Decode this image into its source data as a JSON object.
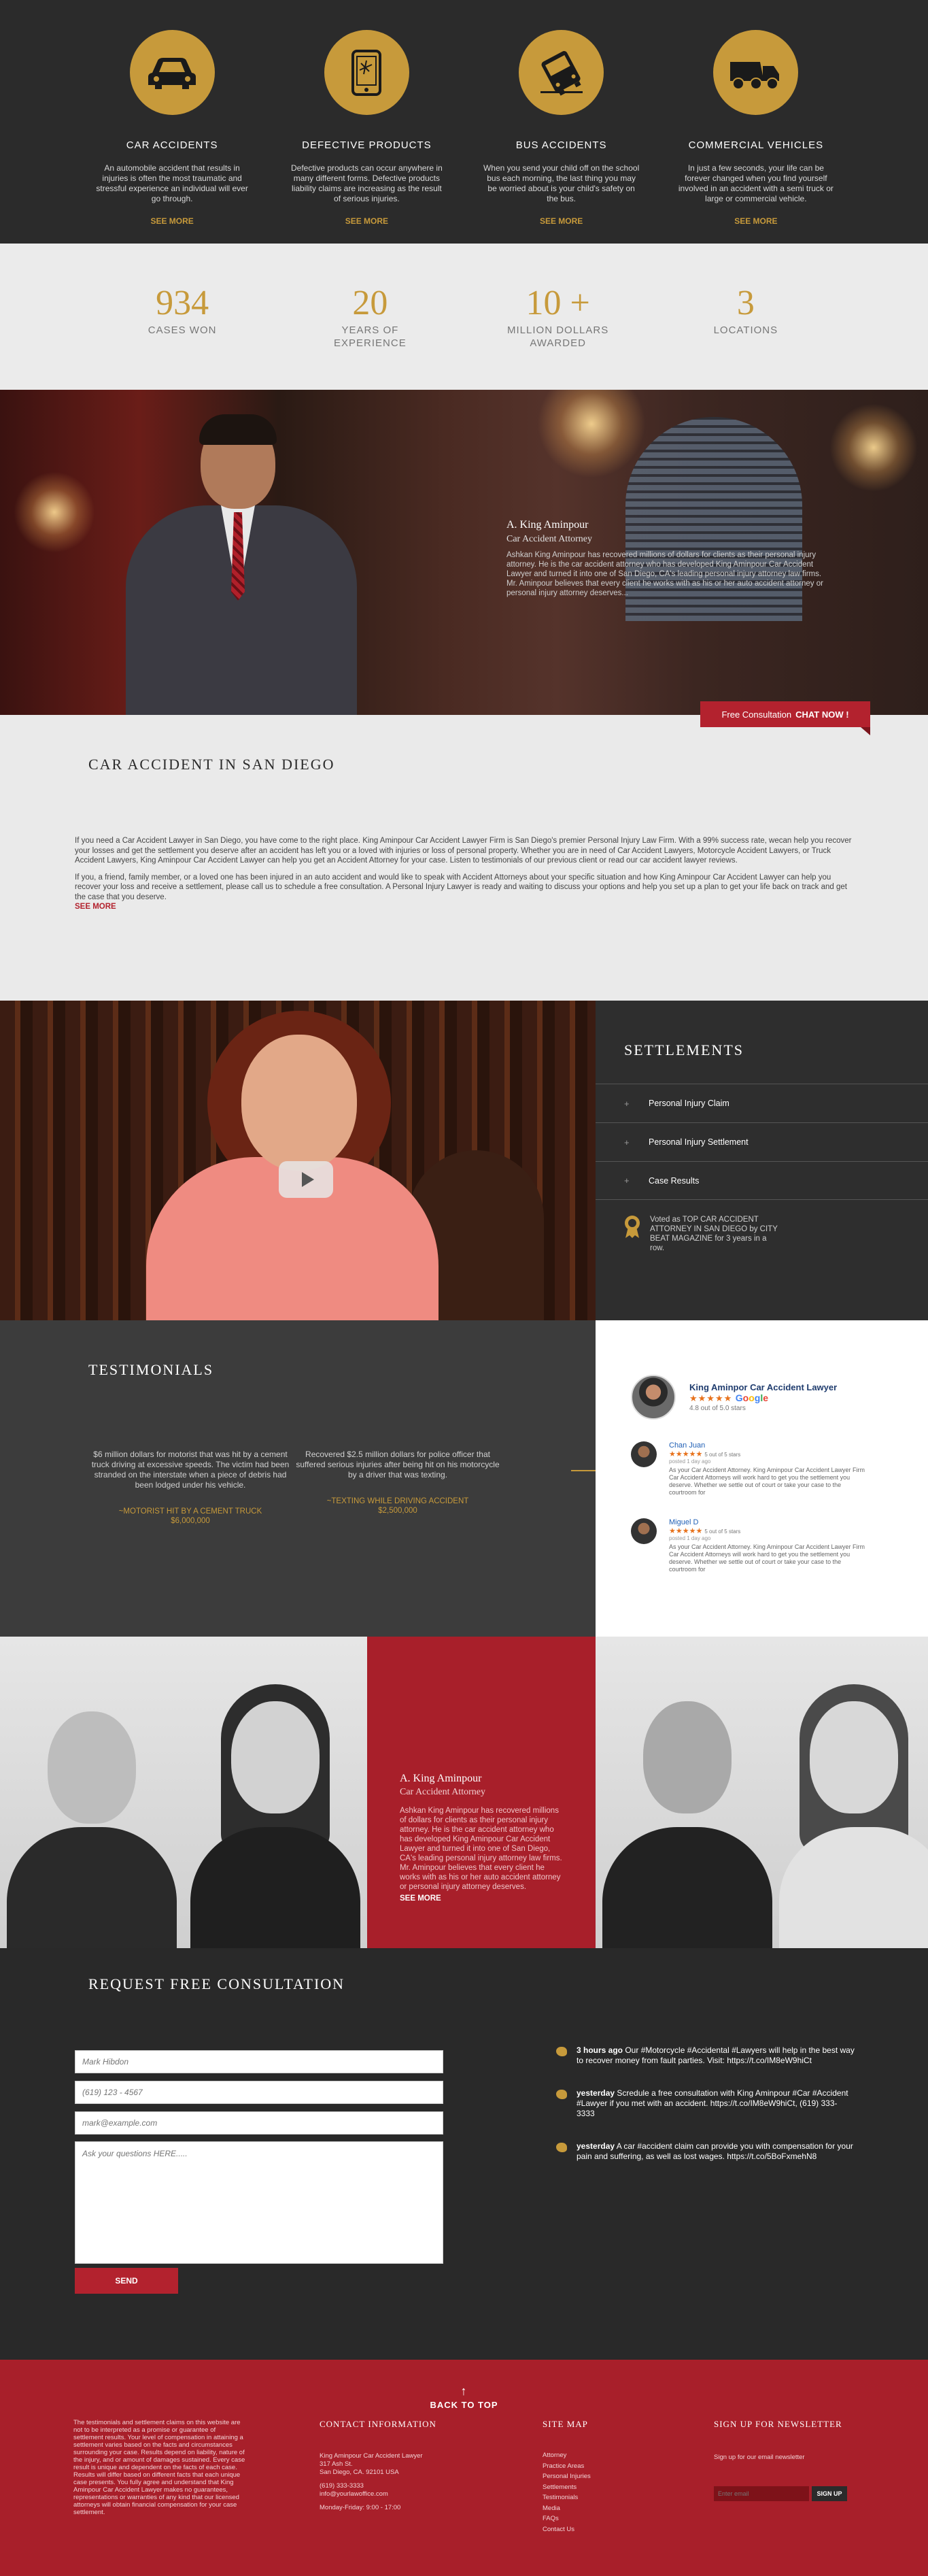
{
  "practice_areas": [
    {
      "title": "CAR ACCIDENTS",
      "icon": "car-icon",
      "text": "An automobile accident that results in injuries is often the most traumatic and stressful experience an individual will ever go through.",
      "link": "SEE MORE"
    },
    {
      "title": "DEFECTIVE PRODUCTS",
      "icon": "phone-icon",
      "text": "Defective products can occur anywhere in many different forms. Defective products liability claims are increasing as the result of serious injuries.",
      "link": "SEE MORE"
    },
    {
      "title": "BUS ACCIDENTS",
      "icon": "bus-icon",
      "text": "When you send your child off on the school bus each morning, the last thing you may be worried about is your child's safety on the bus.",
      "link": "SEE MORE"
    },
    {
      "title": "COMMERCIAL VEHICLES",
      "icon": "truck-icon",
      "text": "In just a few seconds, your life can be forever changed when you find yourself involved in an accident with a semi truck or large or commercial vehicle.",
      "link": "SEE MORE"
    }
  ],
  "stats": [
    {
      "value": "934",
      "label": "CASES WON"
    },
    {
      "value": "20",
      "label": "YEARS OF EXPERIENCE"
    },
    {
      "value": "10 +",
      "label": "MILLION DOLLARS AWARDED"
    },
    {
      "value": "3",
      "label": "LOCATIONS"
    }
  ],
  "hero": {
    "name": "A. King Aminpour",
    "role": "Car Accident Attorney",
    "bio": "Ashkan King Aminpour has recovered millions of dollars for clients as their personal injury attorney. He is the car accident attorney who has developed King Aminpour Car Accident Lawyer and turned it into one of San Diego, CA's leading personal injury attorney law firms. Mr. Aminpour believes that every client he works with as his or her auto accident attorney or personal injury attorney deserves..."
  },
  "chat": {
    "prefix": "Free Consultation",
    "action": "CHAT NOW !"
  },
  "car_accident": {
    "heading": "CAR ACCIDENT IN SAN DIEGO",
    "p1": "If you need a Car Accident Lawyer in San Diego, you have come to the right place. King Aminpour Car Accident Lawyer Firm is San Diego's premier Personal Injury Law Firm. With a 99% success rate, wecan help you recover your losses and get the settlement you deserve after an accident has left you or a loved with injuries or loss of personal property. Whether you are in need of Car Accident Lawyers, Motorcycle Accident Lawyers, or Truck Accident Lawyers, King Aminpour Car Accident Lawyer can help you get an Accident Attorney for your case. Listen to testimonials of our previous client or read our car accident lawyer reviews.",
    "p2": "If you, a friend, family member, or a loved one has been injured in an auto accident and would like to speak with Accident Attorneys about your specific situation and how King Aminpour Car Accident Lawyer can help you recover your loss and receive a settlement, please call us to schedule a free consultation. A Personal Injury Lawyer is ready and waiting to discuss your options and help you set up a plan to get your life back on track and get the case that you deserve.",
    "more": "SEE MORE"
  },
  "settlements": {
    "heading": "SETTLEMENTS",
    "items": [
      "Personal Injury Claim",
      "Personal Injury Settlement",
      "Case Results"
    ],
    "voted": "Voted as TOP CAR ACCIDENT ATTORNEY IN SAN DIEGO by CITY BEAT MAGAZINE for 3 years in a row."
  },
  "testimonials": {
    "heading": "TESTIMONIALS",
    "items": [
      {
        "text": "$6 million dollars for motorist that was hit by a cement truck driving at excessive speeds. The victim had been stranded on the interstate when a piece of debris had been lodged under his vehicle.",
        "who": "~MOTORIST HIT BY A CEMENT TRUCK",
        "amount": "$6,000,000"
      },
      {
        "text": "Recovered $2.5 million dollars for police officer that suffered serious injuries after being hit on his motorcycle by a driver that was texting.",
        "who": "~TEXTING WHILE DRIVING ACCIDENT",
        "amount": "$2,500,000"
      }
    ]
  },
  "reviews": {
    "business": "King Aminpor Car Accident Lawyer",
    "stars": "★★★★★",
    "google": "Google",
    "rating": "4.8 out of 5.0 stars",
    "items": [
      {
        "name": "Chan Juan",
        "stars": "★★★★★",
        "of": "5 out of 5 stars",
        "when": "posted 1 day ago",
        "text": "As your Car Accident Attorney. King Aminpour Car Accident Lawyer Firm Car Accident Attorneys will work hard to get you the settlement you deserve. Whether we settle out of court or take your case to the courtroom for"
      },
      {
        "name": "Miguel D",
        "stars": "★★★★★",
        "of": "5 out of 5 stars",
        "when": "posted 1 day ago",
        "text": "As your Car Accident Attorney. King Aminpour Car Accident Lawyer Firm Car Accident Attorneys will work hard to get you the settlement you deserve. Whether we settle out of court or take your case to the courtroom for"
      }
    ]
  },
  "team_bio": {
    "name": "A. King Aminpour",
    "role": "Car Accident Attorney",
    "bio": "Ashkan King Aminpour has recovered millions of dollars for clients as their personal injury attorney. He is the car accident attorney who has developed King Aminpour Car Accident Lawyer and turned it into one of San Diego, CA's leading personal injury attorney law firms. Mr. Aminpour believes that every client he works with as his or her auto accident attorney or personal injury attorney deserves.",
    "more": "SEE MORE"
  },
  "consultation": {
    "heading": "REQUEST FREE CONSULTATION",
    "name_placeholder": "Mark Hibdon",
    "phone_placeholder": "(619) 123 - 4567",
    "email_placeholder": "mark@example.com",
    "message_placeholder": "Ask your questions HERE.....",
    "send": "SEND"
  },
  "tweets": [
    {
      "when": "3 hours ago",
      "text": " Our #Motorcycle #Accidental #Lawyers will help in the best way to recover money from fault parties. Visit: https://t.co/IM8eW9hiCt"
    },
    {
      "when": "yesterday",
      "text": " Scredule a free consultation with King Aminpour #Car #Accident #Lawyer if you met with an accident. https://t.co/IM8eW9hiCt, (619) 333-3333"
    },
    {
      "when": "yesterday",
      "text": " A car #accident claim can provide you with compensation for your pain and suffering, as well as lost wages. https://t.co/5BoFxmehN8"
    }
  ],
  "footer": {
    "back_to_top": "BACK TO TOP",
    "disclaimer": "The testimonials and settlement claims on this website are not to be interpreted as a promise or guarantee of settlement results. Your level of compensation in attaining a settlement varies based on the facts and circumstances surrounding your case. Results depend on liability, nature of the injury, and or amount of damages sustained. Every case result is unique and dependent on the facts of each case. Results will differ based on different facts that each unique case presents. You fully agree and understand that King Aminpour Car Accident Lawyer makes no guarantees, representations or warranties of any kind that our licensed attorneys will obtain financial compensation for your case settlement.",
    "contact": {
      "heading": "CONTACT INFORMATION",
      "firm": "King Aminpour Car Accident Lawyer",
      "address1": "317 Ash St.",
      "address2": "San Diego, CA. 92101 USA",
      "phone": "(619) 333-3333",
      "email": "info@yourlawoffice.com",
      "hours": "Monday-Friday: 9:00 - 17:00"
    },
    "sitemap": {
      "heading": "SITE MAP",
      "links": [
        "Attorney",
        "Practice Areas",
        "Personal Injuries",
        "Settlements",
        "Testimonials",
        "Media",
        "FAQs",
        "Contact Us"
      ]
    },
    "newsletter": {
      "heading": "SIGN UP FOR NEWSLETTER",
      "text": "Sign up for our email newsletter",
      "placeholder": "Enter email",
      "button": "SIGN UP"
    }
  },
  "colors": {
    "gold": "#c79a3b",
    "red": "#a81f2a",
    "dark": "#2b2b2b"
  }
}
